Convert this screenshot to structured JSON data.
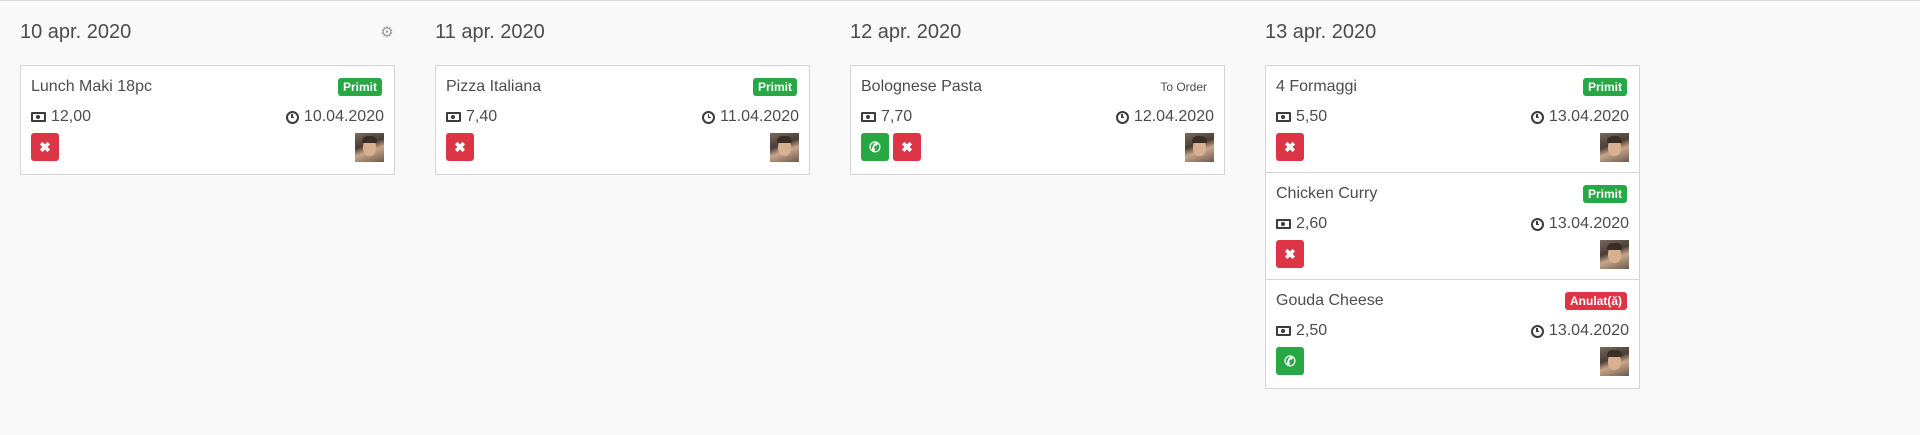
{
  "columns": [
    {
      "title": "10 apr. 2020",
      "cards": [
        {
          "name": "Lunch Maki 18pc",
          "status": "Primit",
          "price": "12,00",
          "date": "10.04.2020"
        }
      ]
    },
    {
      "title": "11 apr. 2020",
      "cards": [
        {
          "name": "Pizza Italiana",
          "status": "Primit",
          "price": "7,40",
          "date": "11.04.2020"
        }
      ]
    },
    {
      "title": "12 apr. 2020",
      "cards": [
        {
          "name": "Bolognese Pasta",
          "status": "To Order",
          "price": "7,70",
          "date": "12.04.2020"
        }
      ]
    },
    {
      "title": "13 apr. 2020",
      "cards": [
        {
          "name": "4 Formaggi",
          "status": "Primit",
          "price": "5,50",
          "date": "13.04.2020"
        },
        {
          "name": "Chicken Curry",
          "status": "Primit",
          "price": "2,60",
          "date": "13.04.2020"
        },
        {
          "name": "Gouda Cheese",
          "status": "Anulat(ă)",
          "price": "2,50",
          "date": "13.04.2020"
        }
      ]
    }
  ],
  "icons": {
    "settings": "gear-icon",
    "price": "money-icon",
    "date": "clock-icon",
    "cancel": "times-icon",
    "call": "phone-icon"
  },
  "colors": {
    "success": "#28a745",
    "danger": "#dc3545",
    "background": "#f9f9f9",
    "card_border": "#d5d5d5"
  }
}
